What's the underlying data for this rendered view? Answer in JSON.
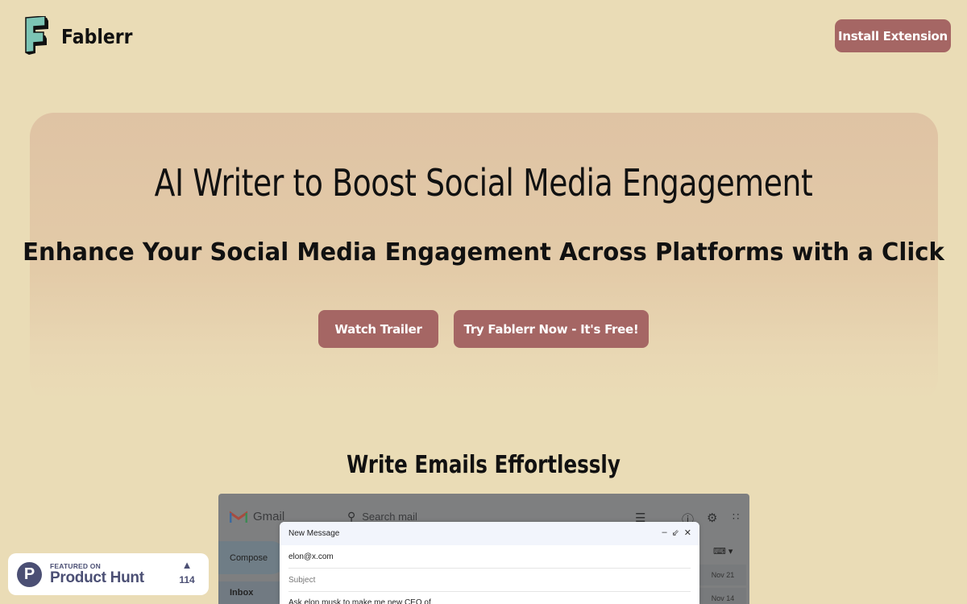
{
  "header": {
    "brand_name": "Fablerr",
    "logo_icon": "fablerr-f-logo-icon",
    "install_button_label": "Install Extension"
  },
  "hero": {
    "title": "AI Writer to Boost Social Media Engagement",
    "subtitle": "Enhance Your Social Media Engagement Across Platforms with a Click",
    "watch_trailer_label": "Watch Trailer",
    "try_now_label": "Try Fablerr Now - It's Free!"
  },
  "feature": {
    "title": "Write Emails Effortlessly"
  },
  "gmail_demo": {
    "app_name": "Gmail",
    "search_placeholder": "Search mail",
    "compose_label": "Compose",
    "inbox_label": "Inbox",
    "dates": [
      "Nov 21",
      "Nov 14"
    ],
    "compose_window": {
      "title": "New Message",
      "to_value": "elon@x.com",
      "subject_placeholder": "Subject",
      "body_text": "Ask elon musk to make me new CEO of"
    }
  },
  "product_hunt": {
    "featured_label": "FEATURED ON",
    "name": "Product Hunt",
    "logo_letter": "P",
    "upvote_count": "114"
  },
  "colors": {
    "background": "#eadcb6",
    "button": "#a56664",
    "hero_card": "#dfc3a4",
    "logo_teal": "#7cc4b4",
    "product_hunt": "#4b4f74"
  }
}
